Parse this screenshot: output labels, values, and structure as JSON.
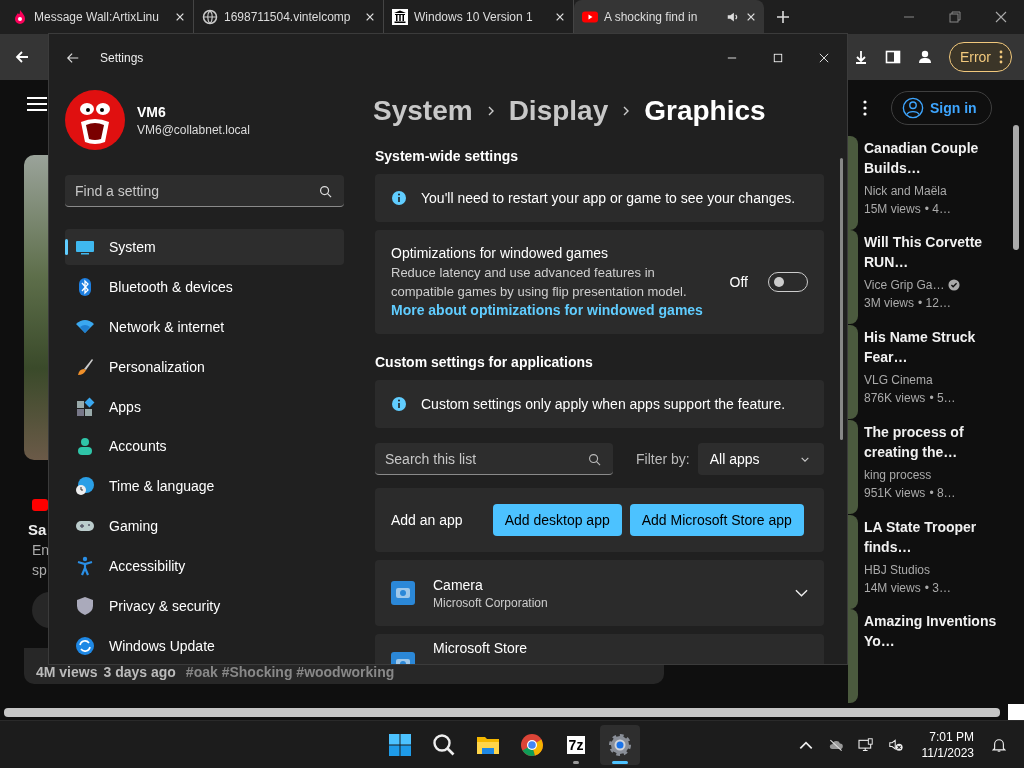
{
  "browser": {
    "tabs": [
      {
        "title": "Message Wall:ArtixLinu",
        "kind": "fandom",
        "selected": false,
        "audio": false
      },
      {
        "title": "1698711504.vintelcomp",
        "kind": "globe",
        "selected": false,
        "audio": false
      },
      {
        "title": "Windows 10 Version 1",
        "kind": "archive",
        "selected": false,
        "audio": false
      },
      {
        "title": "A shocking find in",
        "kind": "youtube",
        "selected": true,
        "audio": true
      }
    ],
    "profile_button": "Error"
  },
  "youtube": {
    "sign_in": "Sign in",
    "partial_title": "Sa",
    "partial_desc": [
      "En",
      "sp"
    ],
    "video_meta": [
      "4M views",
      "3 days ago",
      "#oak #Shocking #woodworking"
    ],
    "recommended": [
      {
        "title": "Canadian Couple Builds…",
        "channel": "Nick and Maëla",
        "verified": false,
        "views": "15M views",
        "age": "• 4…"
      },
      {
        "title": "Will This Corvette RUN…",
        "channel": "Vice Grip Ga…",
        "verified": true,
        "views": "3M views",
        "age": "• 12…"
      },
      {
        "title": "His Name Struck Fear…",
        "channel": "VLG Cinema",
        "verified": false,
        "views": "876K views",
        "age": "• 5…"
      },
      {
        "title": "The process of creating the…",
        "channel": "king process",
        "verified": false,
        "views": "951K views",
        "age": "• 8…"
      },
      {
        "title": "LA State Trooper finds…",
        "channel": "HBJ Studios",
        "verified": false,
        "views": "14M views",
        "age": "• 3…"
      },
      {
        "title": "Amazing Inventions Yo…"
      }
    ]
  },
  "settings": {
    "title": "Settings",
    "user": {
      "name": "VM6",
      "email": "VM6@collabnet.local"
    },
    "search_placeholder": "Find a setting",
    "nav": [
      {
        "label": "System",
        "kind": "system",
        "selected": true
      },
      {
        "label": "Bluetooth & devices",
        "kind": "bluetooth",
        "selected": false
      },
      {
        "label": "Network & internet",
        "kind": "network",
        "selected": false
      },
      {
        "label": "Personalization",
        "kind": "brush",
        "selected": false
      },
      {
        "label": "Apps",
        "kind": "apps",
        "selected": false
      },
      {
        "label": "Accounts",
        "kind": "person",
        "selected": false
      },
      {
        "label": "Time & language",
        "kind": "time",
        "selected": false
      },
      {
        "label": "Gaming",
        "kind": "gaming",
        "selected": false
      },
      {
        "label": "Accessibility",
        "kind": "accessibility",
        "selected": false
      },
      {
        "label": "Privacy & security",
        "kind": "shield",
        "selected": false
      },
      {
        "label": "Windows Update",
        "kind": "update",
        "selected": false
      }
    ],
    "breadcrumb": [
      "System",
      "Display",
      "Graphics"
    ],
    "sections": [
      {
        "heading": "System-wide settings",
        "cards": [
          {
            "kind": "info",
            "text": "You'll need to restart your app or game to see your changes."
          },
          {
            "kind": "toggle",
            "title": "Optimizations for windowed games",
            "description": "Reduce latency and use advanced features in compatible games by using flip presentation model.",
            "link": "More about optimizations for windowed games",
            "state_label": "Off",
            "on": false
          }
        ]
      },
      {
        "heading": "Custom settings for applications",
        "cards": [
          {
            "kind": "info",
            "text": "Custom settings only apply when apps support the feature."
          },
          {
            "kind": "search",
            "placeholder": "Search this list",
            "filter_label": "Filter by:",
            "filter_value": "All apps"
          },
          {
            "kind": "add",
            "label": "Add an app",
            "buttons": [
              "Add desktop app",
              "Add Microsoft Store app"
            ]
          },
          {
            "kind": "app",
            "name": "Camera",
            "publisher": "Microsoft Corporation",
            "expanded": false
          },
          {
            "kind": "app",
            "name": "Microsoft Store"
          }
        ]
      }
    ]
  },
  "taskbar": {
    "apps": [
      {
        "kind": "start",
        "running": false,
        "selected": false
      },
      {
        "kind": "search",
        "running": false,
        "selected": false
      },
      {
        "kind": "explorer",
        "running": false,
        "selected": false
      },
      {
        "kind": "chrome",
        "running": false,
        "selected": false
      },
      {
        "kind": "archiver",
        "label": "7z",
        "running": true,
        "selected": false
      },
      {
        "kind": "settings",
        "running": true,
        "selected": true
      }
    ],
    "time": "7:01 PM",
    "date": "11/1/2023"
  }
}
